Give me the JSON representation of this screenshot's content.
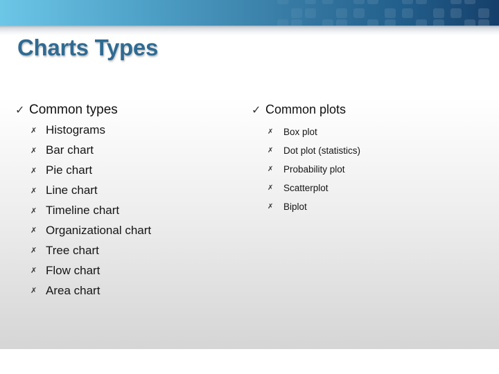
{
  "slide": {
    "title": "Charts Types",
    "left_column": {
      "heading": "Common types",
      "heading_icon": "checkmark-icon",
      "bullet_icon": "cross-bullet-icon",
      "items": [
        "Histograms",
        "Bar chart",
        "Pie chart",
        "Line chart",
        "Timeline chart",
        "Organizational chart",
        "Tree chart",
        "Flow chart",
        "Area chart"
      ]
    },
    "right_column": {
      "heading": "Common plots",
      "heading_icon": "checkmark-icon",
      "bullet_icon": "cross-bullet-icon",
      "items": [
        "Box plot",
        "Dot plot (statistics)",
        "Probability plot",
        "Scatterplot",
        "Biplot"
      ]
    },
    "glyphs": {
      "check": "✓",
      "bullet": "✗"
    },
    "colors": {
      "title": "#2f6b93",
      "banner_start": "#6cc6e6",
      "banner_end": "#153f6a"
    }
  }
}
